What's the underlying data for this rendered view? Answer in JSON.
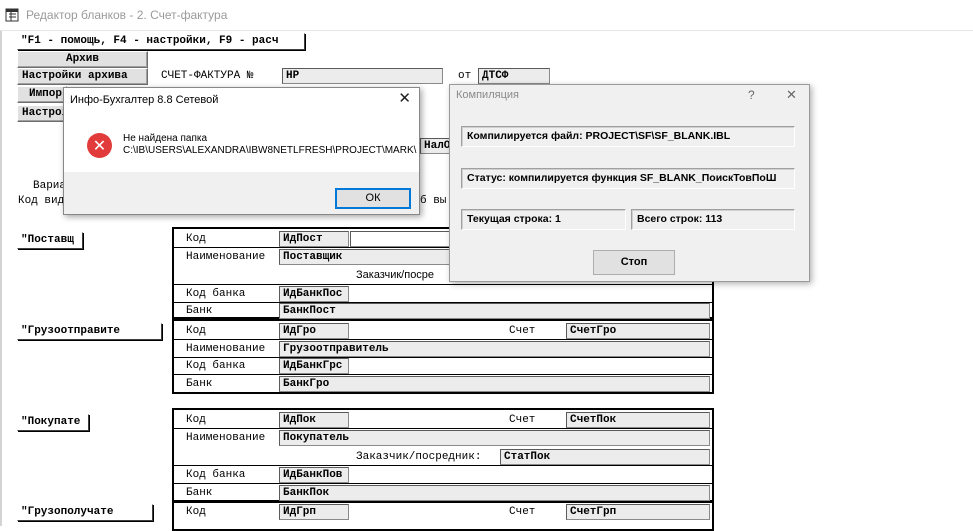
{
  "window": {
    "title": "Редактор бланков -  2. Счет-фактура"
  },
  "toolbar": {
    "hint_button": "\"F1 - помощь, F4 - настройки, F9 - расч",
    "archive_button": "Архив",
    "archive_settings_button": "Настройки архива",
    "import_button": "Импор",
    "settings_button": "Настрої"
  },
  "header": {
    "invoice_label": "СЧЕТ-ФАКТУРА №",
    "invoice_no_field": "НР",
    "from_label": "от",
    "date_field": "ДТСФ",
    "nalob_field": "НалОб",
    "variant_label": "Вариа",
    "kind_code_label": "Код вид",
    "kind_code_suffix": "б вы"
  },
  "sections": [
    {
      "button": "\"Поставщ",
      "rows": [
        {
          "label": "Код",
          "field": "ИдПост"
        },
        {
          "label": "Наименование",
          "field": "Поставщик"
        },
        {
          "label": "Заказчик/посре"
        },
        {
          "label": "Код банка",
          "field": "ИдБанкПос"
        },
        {
          "label": "Банк",
          "field": "БанкПост"
        }
      ]
    },
    {
      "button": "\"Грузоотправите",
      "rows": [
        {
          "label": "Код",
          "field": "ИдГро",
          "acct_label": "Счет",
          "acct_field": "СчетГро"
        },
        {
          "label": "Наименование",
          "field": "Грузоотправитель"
        },
        {
          "label": "Код банка",
          "field": "ИдБанкГрс"
        },
        {
          "label": "Банк",
          "field": "БанкГро"
        }
      ]
    },
    {
      "button": "\"Покупате",
      "rows": [
        {
          "label": "Код",
          "field": "ИдПок",
          "acct_label": "Счет",
          "acct_field": "СчетПок"
        },
        {
          "label": "Наименование",
          "field": "Покупатель"
        },
        {
          "label": "Заказчик/посредник:",
          "field": "СтатПок"
        },
        {
          "label": "Код банка",
          "field": "ИдБанкПов"
        },
        {
          "label": "Банк",
          "field": "БанкПок"
        }
      ]
    },
    {
      "button": "\"Грузополучате",
      "rows": [
        {
          "label": "Код",
          "field": "ИдГрп",
          "acct_label": "Счет",
          "acct_field": "СчетГрп"
        }
      ]
    }
  ],
  "message_box": {
    "title": "Инфо-Бухгалтер 8.8 Сетевой",
    "close": "✕",
    "line1": "Не найдена папка",
    "line2": "C:\\IB\\USERS\\ALEXANDRA\\IBW8NETLFRESH\\PROJECT\\MARK\\",
    "ok": "ОК",
    "icon": "error-icon"
  },
  "compile_dialog": {
    "title": "Компиляция",
    "help": "?",
    "close": "✕",
    "file_line": "Компилируется файл: PROJECT\\SF\\SF_BLANK.IBL",
    "status_line": "Статус: компилируется функция SF_BLANK_ПоискТовПоШ",
    "current_line": "Текущая строка: 1",
    "total_lines": "Всего строк: 113",
    "stop_button": "Стоп"
  },
  "colors": {
    "error": "#e23b3b",
    "dialog_bg": "#f0f0f0",
    "ok_border": "#0078d7"
  }
}
